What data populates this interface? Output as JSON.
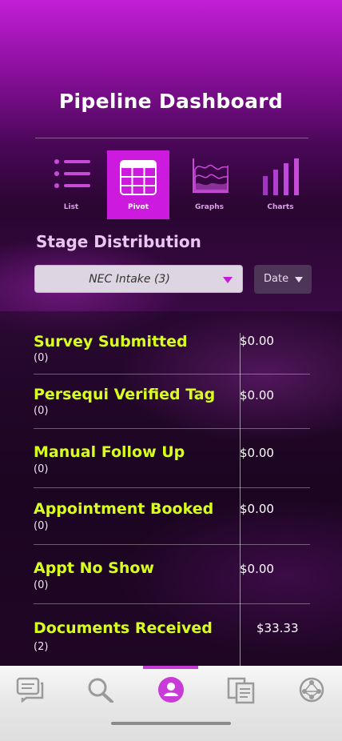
{
  "header": {
    "title": "Pipeline Dashboard"
  },
  "views": [
    {
      "label": "List",
      "icon": "list-icon",
      "active": false
    },
    {
      "label": "Pivot",
      "icon": "pivot-table-icon",
      "active": true
    },
    {
      "label": "Graphs",
      "icon": "area-graph-icon",
      "active": false
    },
    {
      "label": "Charts",
      "icon": "bar-chart-icon",
      "active": false
    }
  ],
  "section": {
    "title": "Stage Distribution"
  },
  "filters": {
    "pipeline_value": "NEC Intake (3)",
    "date_value": "Date"
  },
  "stages": [
    {
      "name": "Survey Submitted",
      "count": "(0)",
      "amount": "$0.00"
    },
    {
      "name": "Persequi Verified Tag",
      "count": "(0)",
      "amount": "$0.00"
    },
    {
      "name": "Manual Follow Up",
      "count": "(0)",
      "amount": "$0.00"
    },
    {
      "name": "Appointment Booked",
      "count": "(0)",
      "amount": "$0.00"
    },
    {
      "name": "Appt No Show",
      "count": "(0)",
      "amount": "$0.00"
    },
    {
      "name": "Documents Received",
      "count": "(2)",
      "amount": "$33.33"
    }
  ],
  "tabbar": {
    "tabs": [
      {
        "icon": "chat-icon",
        "active": false
      },
      {
        "icon": "search-icon",
        "active": false
      },
      {
        "icon": "user-icon",
        "active": true
      },
      {
        "icon": "documents-icon",
        "active": false
      },
      {
        "icon": "network-icon",
        "active": false
      }
    ]
  },
  "colors": {
    "accent": "#cc1adf",
    "stage_name": "#d8ff1c",
    "tab_active": "#c93bd6",
    "tab_inactive": "#9a9a9a"
  }
}
